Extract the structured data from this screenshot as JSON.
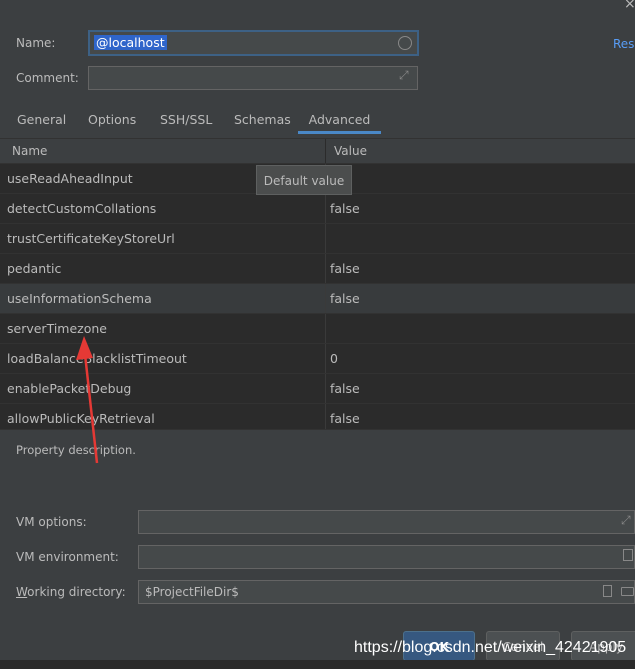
{
  "window": {
    "close_glyph": "×"
  },
  "form": {
    "name_label": "Name:",
    "name_value": "@localhost",
    "comment_label": "Comment:",
    "comment_value": "",
    "reset_link": "Res"
  },
  "tabs": [
    {
      "label": "General",
      "active": false
    },
    {
      "label": "Options",
      "active": false
    },
    {
      "label": "SSH/SSL",
      "active": false
    },
    {
      "label": "Schemas",
      "active": false
    },
    {
      "label": "Advanced",
      "active": true
    }
  ],
  "table": {
    "headers": {
      "name": "Name",
      "value": "Value"
    },
    "rows": [
      {
        "name": "useReadAheadInput",
        "value": ""
      },
      {
        "name": "detectCustomCollations",
        "value": "false"
      },
      {
        "name": "trustCertificateKeyStoreUrl",
        "value": ""
      },
      {
        "name": "pedantic",
        "value": "false"
      },
      {
        "name": "useInformationSchema",
        "value": "false",
        "selected": true
      },
      {
        "name": "serverTimezone",
        "value": ""
      },
      {
        "name": "loadBalanceBlacklistTimeout",
        "value": "0"
      },
      {
        "name": "enablePacketDebug",
        "value": "false"
      },
      {
        "name": "allowPublicKeyRetrieval",
        "value": "false"
      }
    ]
  },
  "tooltip": "Default value",
  "description": "Property description.",
  "vm": {
    "options_label": "VM options:",
    "options_value": "",
    "environment_label": "VM environment:",
    "environment_value": "",
    "working_dir_label_prefix": "W",
    "working_dir_label_rest": "orking directory:",
    "working_dir_value": "$ProjectFileDir$"
  },
  "buttons": {
    "ok": "OK",
    "cancel": "Cancel",
    "apply": "Apply"
  },
  "watermark": "https://blog.csdn.net/weixin_42421905",
  "colors": {
    "accent": "#4a88c7",
    "selection": "#2f65ca",
    "background": "#3c3f41",
    "table_bg": "#2b2b2b",
    "arrow": "#e53935"
  }
}
